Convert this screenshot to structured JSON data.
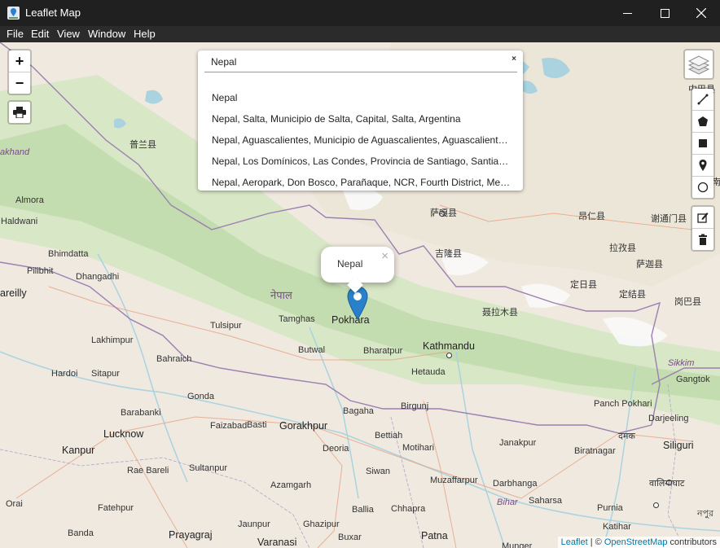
{
  "window": {
    "title": "Leaflet Map"
  },
  "menu": [
    "File",
    "Edit",
    "View",
    "Window",
    "Help"
  ],
  "zoom": {
    "in": "+",
    "out": "−"
  },
  "search": {
    "value": "Nepal",
    "close": "×",
    "results": [
      "Nepal",
      "Nepal, Salta, Municipio de Salta, Capital, Salta, Argentina",
      "Nepal, Aguascalientes, Municipio de Aguascalientes, Aguascalientes, México",
      "Nepal, Los Domínicos, Las Condes, Provincia de Santiago, Santiago Metropolitan Region",
      "Nepal, Aeropark, Don Bosco, Parañaque, NCR, Fourth District, Metro Manila"
    ]
  },
  "popup": {
    "text": "Nepal",
    "close": "×"
  },
  "attribution": {
    "leaflet": "Leaflet",
    "sep": " | © ",
    "osm": "OpenStreetMap",
    "suffix": " contributors"
  },
  "places": {
    "p1": "普兰县",
    "p2": "akhand",
    "p3": "Almora",
    "p4": "Haldwani",
    "p5": "Bhimdatta",
    "p6": "Pilibhit",
    "p7": "Dhangadhi",
    "p8": "areilly",
    "p9": "Lakhimpur",
    "p10": "Bahraich",
    "p11": "Hardoi",
    "p12": "Sitapur",
    "p13": "Gonda",
    "p14": "Barabanki",
    "p15": "Lucknow",
    "p16": "Kanpur",
    "p17": "Rae Bareli",
    "p18": "Sultanpur",
    "p19": "Orai",
    "p20": "Fatehpur",
    "p21": "Banda",
    "p22": "Prayagraj",
    "p23": "Jaunpur",
    "p24": "Varanasi",
    "p25": "Azamgarh",
    "p26": "Ghazipur",
    "p27": "Ballia",
    "p28": "Buxar",
    "p29": "Patna",
    "p30": "Faizabad",
    "p31": "Basti",
    "p32": "Gorakhpur",
    "p33": "Deoria",
    "p34": "Bagaha",
    "p35": "Bettiah",
    "p36": "Motihari",
    "p37": "Siwan",
    "p38": "Chhapra",
    "p39": "Muzaffarpur",
    "p40": "Darbhanga",
    "p41": "Janakpur",
    "p42": "Birgunj",
    "p43": "Hetauda",
    "p44": "Kathmandu",
    "p45": "Bharatpur",
    "p46": "Butwal",
    "p47": "Tulsipur",
    "p48": "Tamghas",
    "p49": "नेपाल",
    "p50": "Pokhara",
    "p51": "萨嘎县",
    "p52": "吉隆县",
    "p53": "聂拉木县",
    "p54": "定日县",
    "p55": "昂仁县",
    "p56": "谢通门县",
    "p57": "拉孜县",
    "p58": "萨迦县",
    "p59": "定结县",
    "p60": "岗巴县",
    "p61": "Sikkim",
    "p62": "Gangtok",
    "p63": "Panch Pokhari",
    "p64": "Darjeeling",
    "p65": "Siliguri",
    "p66": "Biratnagar",
    "p67": "दमक",
    "p68": "Saharsa",
    "p69": "Bihar",
    "p70": "Purnia",
    "p71": "Katihar",
    "p72": "वालियाघाट",
    "p73": "নপুর",
    "p74": "南",
    "p75": "中巴县",
    "p76": "Munger"
  }
}
